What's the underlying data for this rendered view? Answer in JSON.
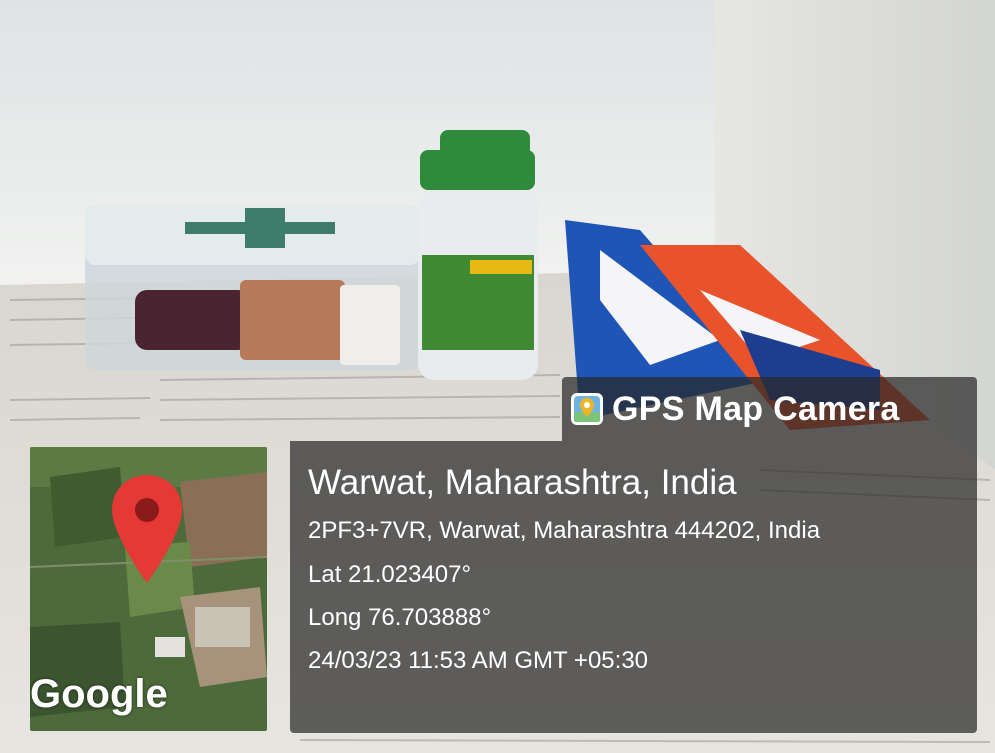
{
  "photo": {
    "description_icon": "camera-photo"
  },
  "badge": {
    "title": "GPS Map Camera",
    "icon": "gps-map-camera-logo-icon"
  },
  "map": {
    "provider_label": "Google",
    "pin_color": "#e53935"
  },
  "location": {
    "city_line": "Warwat, Maharashtra, India",
    "address_line": "2PF3+7VR, Warwat, Maharashtra 444202, India",
    "lat_line": "Lat 21.023407°",
    "long_line": "Long 76.703888°",
    "datetime_line": "24/03/23 11:53 AM GMT +05:30"
  }
}
